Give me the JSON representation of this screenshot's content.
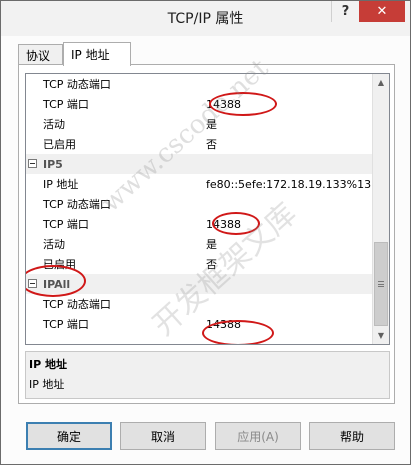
{
  "window": {
    "title": "TCP/IP 属性",
    "help_glyph": "?",
    "close_glyph": "✕"
  },
  "tabs": [
    {
      "label": "协议"
    },
    {
      "label": "IP 地址"
    }
  ],
  "rows": [
    {
      "label": "TCP 动态端口",
      "value": ""
    },
    {
      "label": "TCP 端口",
      "value": "14388"
    },
    {
      "label": "活动",
      "value": "是"
    },
    {
      "label": "已启用",
      "value": "否"
    },
    {
      "label": "IP5",
      "value": "",
      "section": true
    },
    {
      "label": "IP 地址",
      "value": "fe80::5efe:172.18.19.133%13"
    },
    {
      "label": "TCP 动态端口",
      "value": ""
    },
    {
      "label": "TCP 端口",
      "value": "14388"
    },
    {
      "label": "活动",
      "value": "是"
    },
    {
      "label": "已启用",
      "value": "否"
    },
    {
      "label": "IPAll",
      "value": "",
      "section": true
    },
    {
      "label": "TCP 动态端口",
      "value": ""
    },
    {
      "label": "TCP 端口",
      "value": "14388"
    }
  ],
  "scrollbar": {
    "up_glyph": "▲",
    "down_glyph": "▼"
  },
  "description": {
    "title": "IP 地址",
    "text": "IP 地址"
  },
  "watermark": {
    "line1": "www.cscode.net",
    "line2": "开发框架文库"
  },
  "buttons": {
    "ok": "确定",
    "cancel": "取消",
    "apply": "应用(A)",
    "help": "帮助"
  },
  "colors": {
    "highlight": "#d01818",
    "close_button": "#c63d37",
    "default_button_border": "#3c7fb1"
  }
}
